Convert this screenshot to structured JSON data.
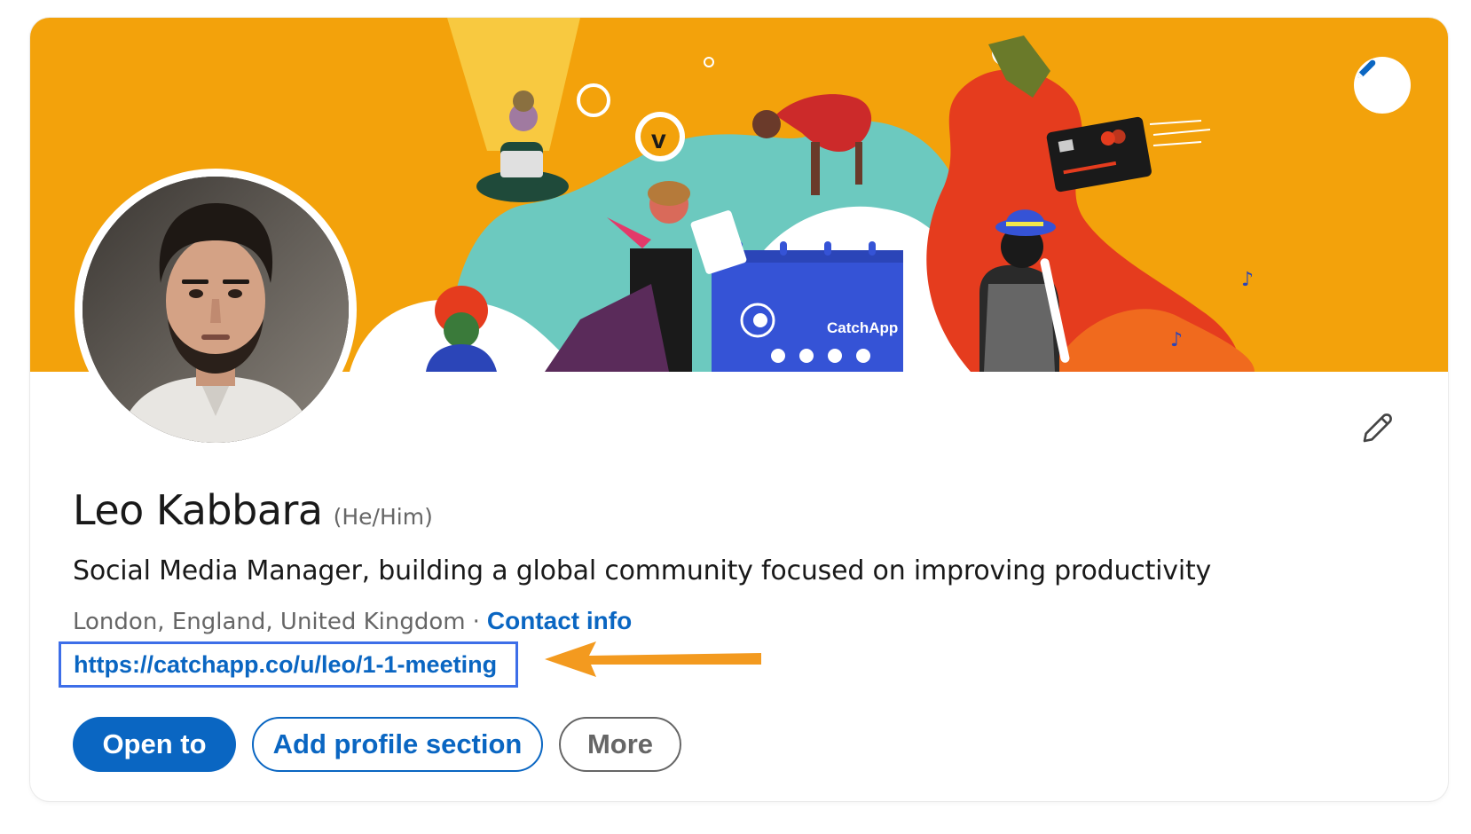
{
  "banner": {
    "brand_label": "CatchApp",
    "edit_icon": "pencil-icon",
    "colors": {
      "background": "#f3a20b",
      "calendar": "#3553d6",
      "teal": "#6cc9bf",
      "red": "#e53c1e"
    }
  },
  "profile": {
    "name": "Leo Kabbara",
    "pronouns": "(He/Him)",
    "headline": "Social Media Manager, building a global community focused on improving productivity",
    "location": "London, England, United Kingdom",
    "separator": "·",
    "contact_info_label": "Contact info",
    "website": "https://catchapp.co/u/leo/1-1-meeting",
    "edit_icon": "pencil-outline-icon"
  },
  "actions": {
    "open_to": "Open to",
    "add_profile_section": "Add profile section",
    "more": "More"
  },
  "annotation": {
    "highlight_color": "#3d6ee8",
    "arrow_color": "#f39a1f"
  },
  "theme": {
    "link": "#0a66c2",
    "text": "#191919",
    "muted": "#666666"
  }
}
